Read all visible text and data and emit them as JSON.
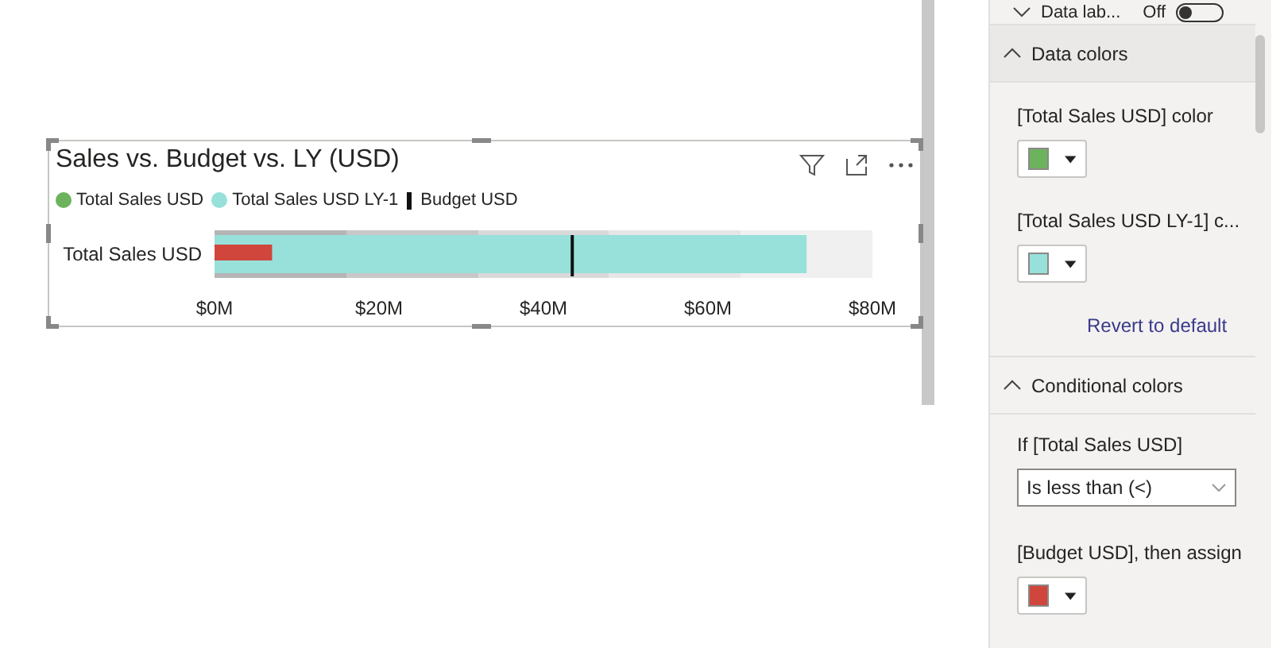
{
  "visual": {
    "title": "Sales vs. Budget vs. LY (USD)",
    "legend": [
      {
        "kind": "dot"
      },
      {
        "kind": "dot"
      },
      {
        "kind": "bar"
      }
    ],
    "chart_data": {
      "type": "bar",
      "orientation": "horizontal",
      "categories": [
        "Total Sales USD"
      ],
      "series": [
        {
          "name": "Total Sales USD",
          "color": "#d0463d",
          "values": [
            7
          ]
        },
        {
          "name": "Total Sales USD LY-1",
          "color": "#97e1da",
          "values": [
            72
          ]
        }
      ],
      "ref_lines": [
        {
          "axis": "x",
          "value": 43.5,
          "label": "Budget USD",
          "color": "#111111"
        }
      ],
      "xlim": [
        0,
        80
      ],
      "xticks": [
        {
          "value": 0,
          "label": "$0M"
        },
        {
          "value": 20,
          "label": "$20M"
        },
        {
          "value": 40,
          "label": "$40M"
        },
        {
          "value": 60,
          "label": "$60M"
        },
        {
          "value": 80,
          "label": "$80M"
        }
      ]
    }
  },
  "format_pane": {
    "top_row": {
      "label": "Data lab...",
      "toggle_text": "Off",
      "on": false
    },
    "data_colors": {
      "title": "Data colors",
      "expanded": true,
      "items": [
        {
          "label": "[Total Sales USD] color",
          "color": "#6db35e"
        },
        {
          "label": "[Total Sales USD LY-1] c...",
          "color": "#97e1da"
        }
      ],
      "revert": "Revert to default"
    },
    "conditional_colors": {
      "title": "Conditional colors",
      "expanded": true,
      "condition_label": "If [Total Sales USD]",
      "operator": "Is less than (<)",
      "then_label": "[Budget USD], then assign",
      "assign": {
        "color": "#d0463d"
      }
    }
  }
}
